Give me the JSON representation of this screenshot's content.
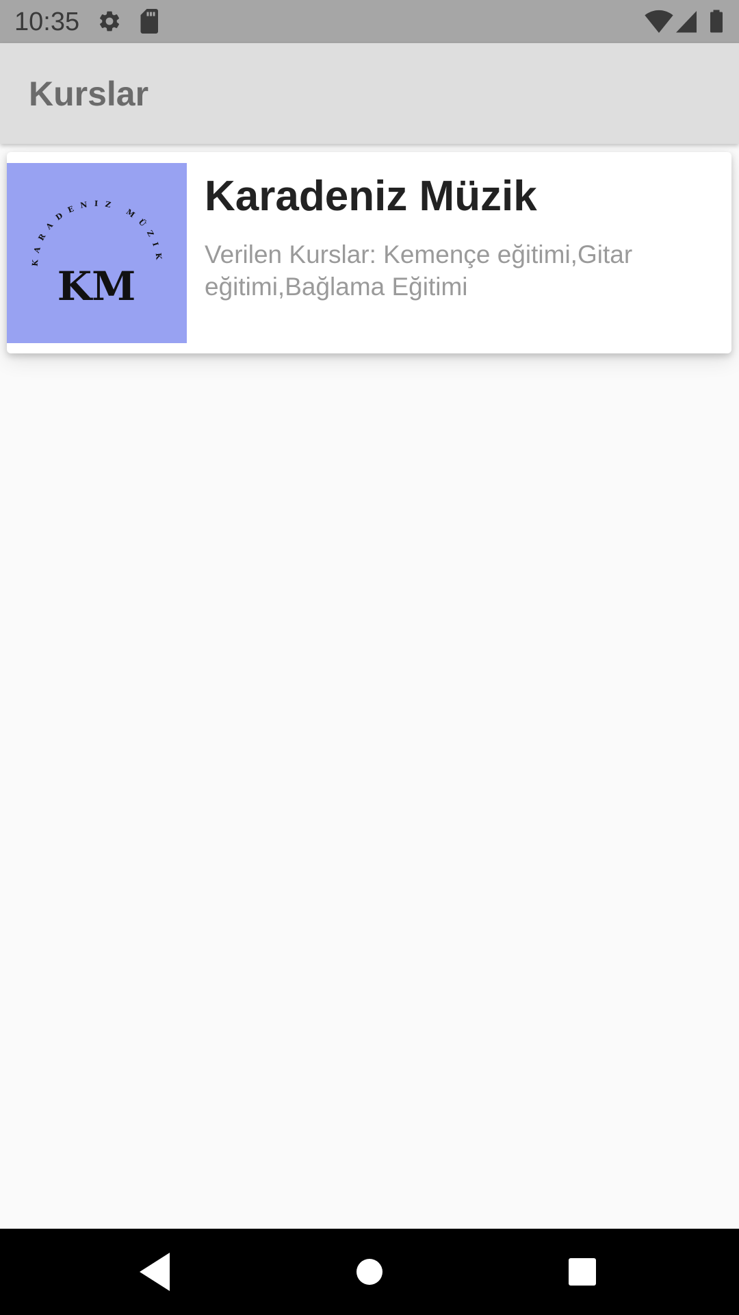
{
  "status_bar": {
    "time": "10:35",
    "icons": [
      "settings-gear-icon",
      "sd-card-icon",
      "wifi-icon",
      "cell-signal-icon",
      "battery-icon"
    ]
  },
  "app_bar": {
    "title": "Kurslar"
  },
  "courses": [
    {
      "logo": {
        "initials": "KM",
        "arc_text": "KARADENIZ MÜZIK",
        "background": "#98a2f2"
      },
      "title": "Karadeniz Müzik",
      "subtitle": "Verilen Kurslar: Kemençe eğitimi,Gitar eğitimi,Bağlama Eğitimi"
    }
  ],
  "nav_bar": {
    "buttons": [
      "back-icon",
      "home-icon",
      "recents-icon"
    ]
  },
  "colors": {
    "status_bar": "#a6a6a6",
    "app_bar": "#dedede",
    "background": "#fafafa",
    "logo_background": "#98a2f2"
  }
}
